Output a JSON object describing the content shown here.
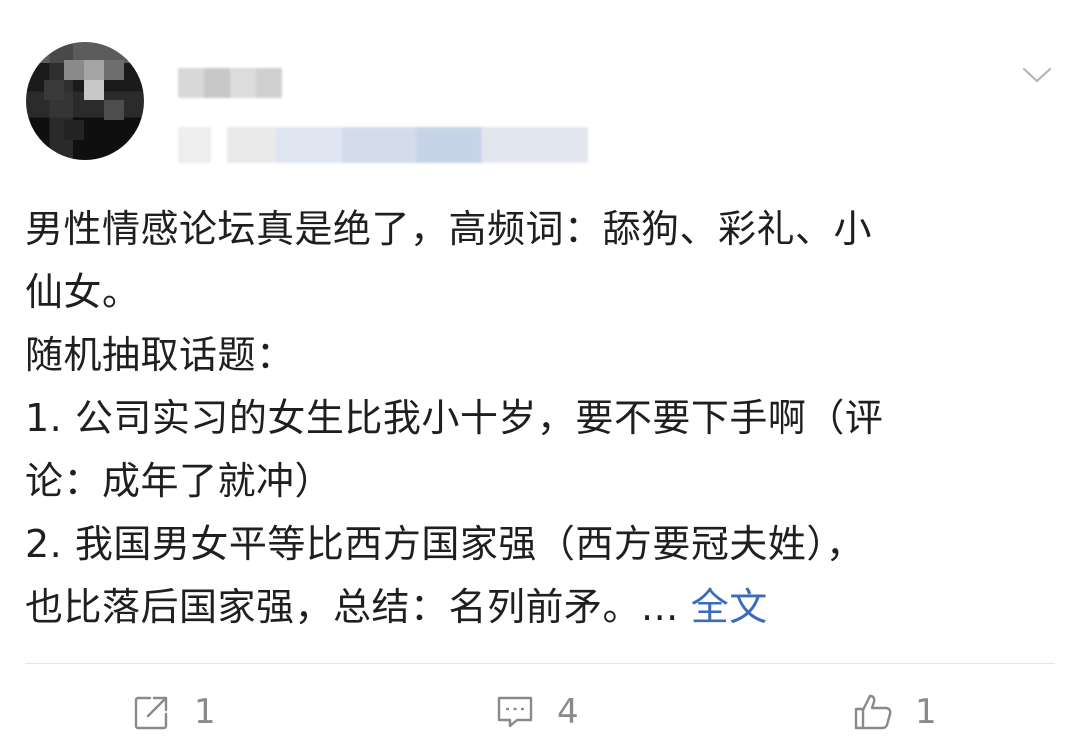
{
  "post": {
    "content_lines": [
      "男性情感论坛真是绝了，高频词：舔狗、彩礼、小",
      "仙女。",
      "随机抽取话题：",
      "1. 公司实习的女生比我小十岁，要不要下手啊（评",
      "论：成年了就冲）",
      "2. 我国男女平等比西方国家强（西方要冠夫姓），",
      "也比落后国家强，总结：名列前矛。..."
    ],
    "more_link": "全文"
  },
  "actions": {
    "repost_count": "1",
    "comment_count": "4",
    "like_count": "1"
  },
  "icons": {
    "menu": "chevron-down-icon",
    "repost": "repost-icon",
    "comment": "comment-icon",
    "like": "thumbs-up-icon"
  }
}
